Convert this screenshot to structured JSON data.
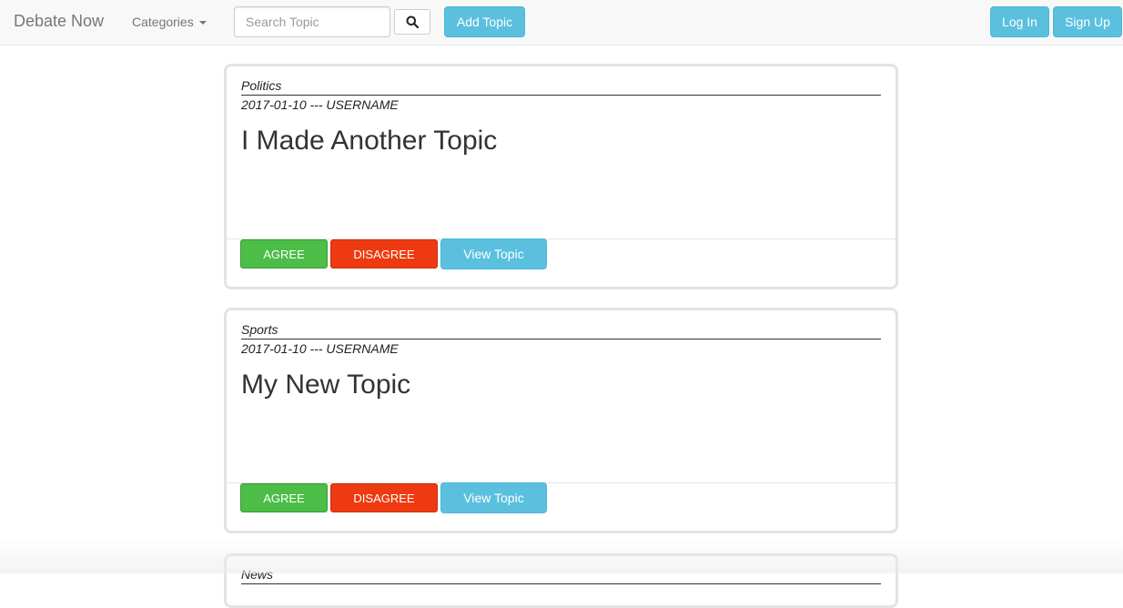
{
  "navbar": {
    "brand": "Debate Now",
    "categories_label": "Categories",
    "search_placeholder": "Search Topic",
    "add_topic_label": "Add Topic",
    "login_label": "Log In",
    "signup_label": "Sign Up",
    "icons": {
      "search": "magnifier-icon",
      "dropdown": "caret-down-icon"
    }
  },
  "topics": [
    {
      "category": "Politics",
      "meta": "2017-01-10 --- USERNAME",
      "title": "I Made Another Topic",
      "agree_label": "AGREE",
      "disagree_label": "DISAGREE",
      "view_label": "View Topic"
    },
    {
      "category": "Sports",
      "meta": "2017-01-10 --- USERNAME",
      "title": "My New Topic",
      "agree_label": "AGREE",
      "disagree_label": "DISAGREE",
      "view_label": "View Topic"
    },
    {
      "category": "News"
    }
  ],
  "colors": {
    "info": "#5bc0de",
    "agree": "#4cbd47",
    "disagree": "#ee3a10",
    "navbar_bg": "#f8f8f8"
  }
}
